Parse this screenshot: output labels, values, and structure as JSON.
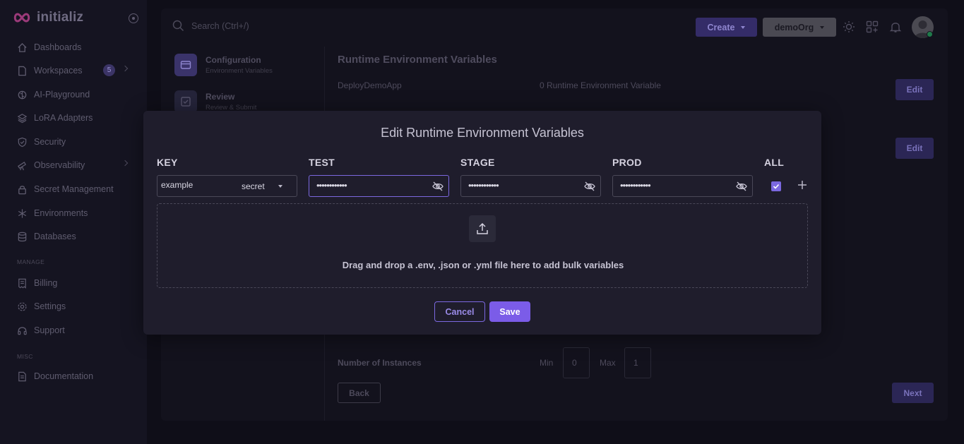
{
  "brand": {
    "name": "initializ"
  },
  "sidebar": {
    "items": [
      {
        "label": "Dashboards",
        "icon": "dashboard-icon"
      },
      {
        "label": "Workspaces",
        "icon": "file-icon",
        "badge": "5",
        "chevron": true
      },
      {
        "label": "AI-Playground",
        "icon": "ai-brain-icon"
      },
      {
        "label": "LoRA Adapters",
        "icon": "layers-icon"
      },
      {
        "label": "Security",
        "icon": "shield-icon"
      },
      {
        "label": "Observability",
        "icon": "telescope-icon",
        "chevron": true
      },
      {
        "label": "Secret Management",
        "icon": "lock-icon"
      },
      {
        "label": "Environments",
        "icon": "snowflake-icon"
      },
      {
        "label": "Databases",
        "icon": "database-icon"
      }
    ],
    "manage_label": "MANAGE",
    "manage_items": [
      {
        "label": "Billing",
        "icon": "receipt-icon"
      },
      {
        "label": "Settings",
        "icon": "gear-icon"
      },
      {
        "label": "Support",
        "icon": "headset-icon"
      }
    ],
    "misc_label": "MISC",
    "misc_items": [
      {
        "label": "Documentation",
        "icon": "document-icon"
      }
    ]
  },
  "header": {
    "search_placeholder": "Search (Ctrl+/)",
    "create_label": "Create",
    "org_label": "demoOrg"
  },
  "steps": [
    {
      "title": "Configuration",
      "subtitle": "Environment Variables"
    },
    {
      "title": "Review",
      "subtitle": "Review & Submit"
    }
  ],
  "page": {
    "section_title": "Runtime Environment Variables",
    "app_name": "DeployDemoApp",
    "var_count": "0 Runtime Environment Variable",
    "edit_label": "Edit",
    "instances_label": "Number of Instances",
    "min_label": "Min",
    "min_value": "0",
    "max_label": "Max",
    "max_value": "1",
    "back_label": "Back",
    "next_label": "Next"
  },
  "modal": {
    "title": "Edit Runtime Environment Variables",
    "columns": {
      "key": "KEY",
      "test": "TEST",
      "stage": "STAGE",
      "prod": "PROD",
      "all": "ALL"
    },
    "row": {
      "key": "example",
      "type": "secret",
      "test_value": "••••••••••••",
      "stage_value": "••••••••••••",
      "prod_value": "••••••••••••",
      "all_checked": true
    },
    "drop_text": "Drag and drop a .env, .json or .yml file here to add bulk variables",
    "cancel_label": "Cancel",
    "save_label": "Save"
  },
  "colors": {
    "accent": "#7b5ce8",
    "accent_border": "#7b68e0",
    "online": "#1f7a4a"
  }
}
